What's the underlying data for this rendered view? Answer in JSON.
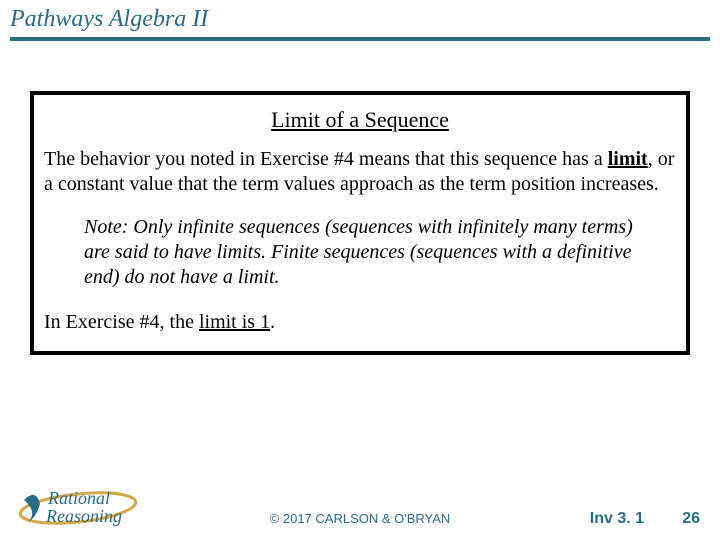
{
  "header": {
    "course_title": "Pathways Algebra II"
  },
  "box": {
    "title": "Limit of a Sequence",
    "para1_a": "The behavior you noted in Exercise #4 means that this sequence has a ",
    "para1_limit_word": "limit",
    "para1_b": ", or a constant value that the term values approach as the term position increases.",
    "note": "Note: Only infinite sequences (sequences with infinitely many terms) are said to have limits. Finite sequences (sequences with a definitive end) do not have a limit.",
    "para2_a": "In Exercise #4, the ",
    "para2_underline": "limit is 1",
    "para2_b": "."
  },
  "footer": {
    "logo_top": "Rational",
    "logo_bottom": "Reasoning",
    "copyright": "© 2017 CARLSON & O'BRYAN",
    "inv": "Inv 3. 1",
    "page": "26"
  }
}
